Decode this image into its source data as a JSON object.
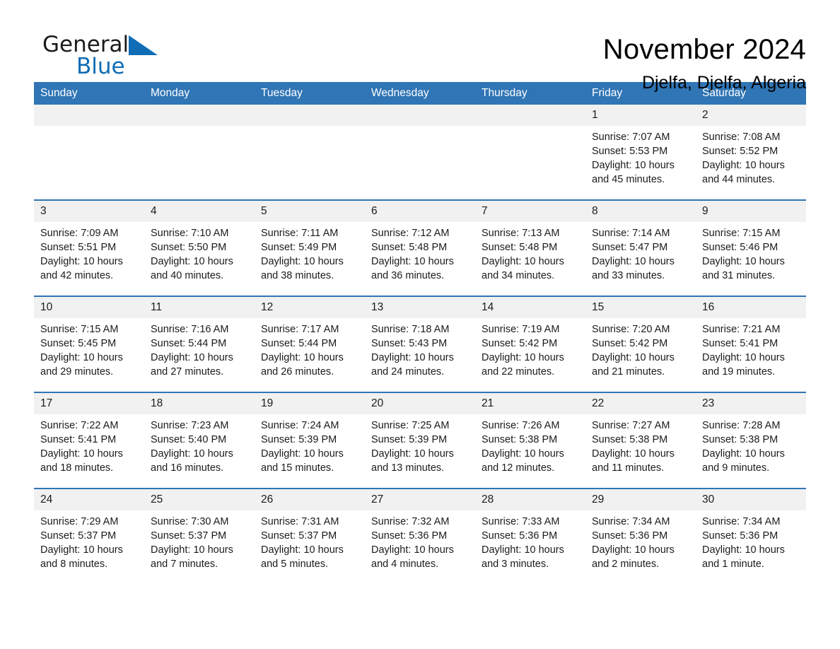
{
  "brand": {
    "name_part1": "General",
    "name_part2": "Blue",
    "triangle_color": "#0f6cb5",
    "logo_icon": "triangle-icon"
  },
  "header": {
    "month_title": "November 2024",
    "location": "Djelfa, Djelfa, Algeria"
  },
  "theme": {
    "header_blue": "#3075b5",
    "daynum_gray": "#f1f1f1",
    "text": "#1b1b1b"
  },
  "calendar": {
    "weekday_headers": [
      "Sunday",
      "Monday",
      "Tuesday",
      "Wednesday",
      "Thursday",
      "Friday",
      "Saturday"
    ],
    "weeks": [
      [
        {
          "day": "",
          "lines": [
            "",
            "",
            "",
            ""
          ],
          "empty": true
        },
        {
          "day": "",
          "lines": [
            "",
            "",
            "",
            ""
          ],
          "empty": true
        },
        {
          "day": "",
          "lines": [
            "",
            "",
            "",
            ""
          ],
          "empty": true
        },
        {
          "day": "",
          "lines": [
            "",
            "",
            "",
            ""
          ],
          "empty": true
        },
        {
          "day": "",
          "lines": [
            "",
            "",
            "",
            ""
          ],
          "empty": true
        },
        {
          "day": "1",
          "lines": [
            "Sunrise: 7:07 AM",
            "Sunset: 5:53 PM",
            "Daylight: 10 hours",
            "and 45 minutes."
          ],
          "empty": false
        },
        {
          "day": "2",
          "lines": [
            "Sunrise: 7:08 AM",
            "Sunset: 5:52 PM",
            "Daylight: 10 hours",
            "and 44 minutes."
          ],
          "empty": false
        }
      ],
      [
        {
          "day": "3",
          "lines": [
            "Sunrise: 7:09 AM",
            "Sunset: 5:51 PM",
            "Daylight: 10 hours",
            "and 42 minutes."
          ],
          "empty": false
        },
        {
          "day": "4",
          "lines": [
            "Sunrise: 7:10 AM",
            "Sunset: 5:50 PM",
            "Daylight: 10 hours",
            "and 40 minutes."
          ],
          "empty": false
        },
        {
          "day": "5",
          "lines": [
            "Sunrise: 7:11 AM",
            "Sunset: 5:49 PM",
            "Daylight: 10 hours",
            "and 38 minutes."
          ],
          "empty": false
        },
        {
          "day": "6",
          "lines": [
            "Sunrise: 7:12 AM",
            "Sunset: 5:48 PM",
            "Daylight: 10 hours",
            "and 36 minutes."
          ],
          "empty": false
        },
        {
          "day": "7",
          "lines": [
            "Sunrise: 7:13 AM",
            "Sunset: 5:48 PM",
            "Daylight: 10 hours",
            "and 34 minutes."
          ],
          "empty": false
        },
        {
          "day": "8",
          "lines": [
            "Sunrise: 7:14 AM",
            "Sunset: 5:47 PM",
            "Daylight: 10 hours",
            "and 33 minutes."
          ],
          "empty": false
        },
        {
          "day": "9",
          "lines": [
            "Sunrise: 7:15 AM",
            "Sunset: 5:46 PM",
            "Daylight: 10 hours",
            "and 31 minutes."
          ],
          "empty": false
        }
      ],
      [
        {
          "day": "10",
          "lines": [
            "Sunrise: 7:15 AM",
            "Sunset: 5:45 PM",
            "Daylight: 10 hours",
            "and 29 minutes."
          ],
          "empty": false
        },
        {
          "day": "11",
          "lines": [
            "Sunrise: 7:16 AM",
            "Sunset: 5:44 PM",
            "Daylight: 10 hours",
            "and 27 minutes."
          ],
          "empty": false
        },
        {
          "day": "12",
          "lines": [
            "Sunrise: 7:17 AM",
            "Sunset: 5:44 PM",
            "Daylight: 10 hours",
            "and 26 minutes."
          ],
          "empty": false
        },
        {
          "day": "13",
          "lines": [
            "Sunrise: 7:18 AM",
            "Sunset: 5:43 PM",
            "Daylight: 10 hours",
            "and 24 minutes."
          ],
          "empty": false
        },
        {
          "day": "14",
          "lines": [
            "Sunrise: 7:19 AM",
            "Sunset: 5:42 PM",
            "Daylight: 10 hours",
            "and 22 minutes."
          ],
          "empty": false
        },
        {
          "day": "15",
          "lines": [
            "Sunrise: 7:20 AM",
            "Sunset: 5:42 PM",
            "Daylight: 10 hours",
            "and 21 minutes."
          ],
          "empty": false
        },
        {
          "day": "16",
          "lines": [
            "Sunrise: 7:21 AM",
            "Sunset: 5:41 PM",
            "Daylight: 10 hours",
            "and 19 minutes."
          ],
          "empty": false
        }
      ],
      [
        {
          "day": "17",
          "lines": [
            "Sunrise: 7:22 AM",
            "Sunset: 5:41 PM",
            "Daylight: 10 hours",
            "and 18 minutes."
          ],
          "empty": false
        },
        {
          "day": "18",
          "lines": [
            "Sunrise: 7:23 AM",
            "Sunset: 5:40 PM",
            "Daylight: 10 hours",
            "and 16 minutes."
          ],
          "empty": false
        },
        {
          "day": "19",
          "lines": [
            "Sunrise: 7:24 AM",
            "Sunset: 5:39 PM",
            "Daylight: 10 hours",
            "and 15 minutes."
          ],
          "empty": false
        },
        {
          "day": "20",
          "lines": [
            "Sunrise: 7:25 AM",
            "Sunset: 5:39 PM",
            "Daylight: 10 hours",
            "and 13 minutes."
          ],
          "empty": false
        },
        {
          "day": "21",
          "lines": [
            "Sunrise: 7:26 AM",
            "Sunset: 5:38 PM",
            "Daylight: 10 hours",
            "and 12 minutes."
          ],
          "empty": false
        },
        {
          "day": "22",
          "lines": [
            "Sunrise: 7:27 AM",
            "Sunset: 5:38 PM",
            "Daylight: 10 hours",
            "and 11 minutes."
          ],
          "empty": false
        },
        {
          "day": "23",
          "lines": [
            "Sunrise: 7:28 AM",
            "Sunset: 5:38 PM",
            "Daylight: 10 hours",
            "and 9 minutes."
          ],
          "empty": false
        }
      ],
      [
        {
          "day": "24",
          "lines": [
            "Sunrise: 7:29 AM",
            "Sunset: 5:37 PM",
            "Daylight: 10 hours",
            "and 8 minutes."
          ],
          "empty": false
        },
        {
          "day": "25",
          "lines": [
            "Sunrise: 7:30 AM",
            "Sunset: 5:37 PM",
            "Daylight: 10 hours",
            "and 7 minutes."
          ],
          "empty": false
        },
        {
          "day": "26",
          "lines": [
            "Sunrise: 7:31 AM",
            "Sunset: 5:37 PM",
            "Daylight: 10 hours",
            "and 5 minutes."
          ],
          "empty": false
        },
        {
          "day": "27",
          "lines": [
            "Sunrise: 7:32 AM",
            "Sunset: 5:36 PM",
            "Daylight: 10 hours",
            "and 4 minutes."
          ],
          "empty": false
        },
        {
          "day": "28",
          "lines": [
            "Sunrise: 7:33 AM",
            "Sunset: 5:36 PM",
            "Daylight: 10 hours",
            "and 3 minutes."
          ],
          "empty": false
        },
        {
          "day": "29",
          "lines": [
            "Sunrise: 7:34 AM",
            "Sunset: 5:36 PM",
            "Daylight: 10 hours",
            "and 2 minutes."
          ],
          "empty": false
        },
        {
          "day": "30",
          "lines": [
            "Sunrise: 7:34 AM",
            "Sunset: 5:36 PM",
            "Daylight: 10 hours",
            "and 1 minute."
          ],
          "empty": false
        }
      ]
    ]
  }
}
